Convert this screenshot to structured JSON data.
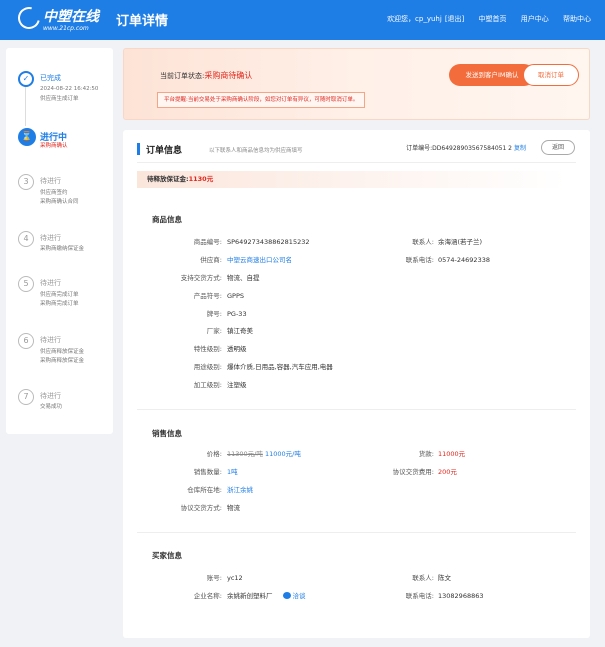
{
  "header": {
    "logo_name": "中塑在线",
    "logo_url": "www.21cp.com",
    "page_title": "订单详情",
    "welcome": "欢迎您，cp_yuhj",
    "logout": "[退出]",
    "nav": [
      "中塑首页",
      "用户中心",
      "帮助中心"
    ]
  },
  "steps": [
    {
      "num": "✓",
      "state": "done",
      "title": "已完成",
      "lines": [
        "2024-08-22 16:42:50",
        "供应商生成订单"
      ]
    },
    {
      "num": "⌛",
      "state": "active",
      "title": "进行中",
      "lines": [
        "采购商确认"
      ]
    },
    {
      "num": "3",
      "state": "pending",
      "title": "待进行",
      "lines": [
        "供应商签约",
        "采购商确认合同"
      ]
    },
    {
      "num": "4",
      "state": "pending",
      "title": "待进行",
      "lines": [
        "采购商缴纳保证金"
      ]
    },
    {
      "num": "5",
      "state": "pending",
      "title": "待进行",
      "lines": [
        "供应商完成订单",
        "采购商完成订单"
      ]
    },
    {
      "num": "6",
      "state": "pending",
      "title": "待进行",
      "lines": [
        "供应商释放保证金",
        "采购商释放保证金"
      ]
    },
    {
      "num": "7",
      "state": "pending",
      "title": "待进行",
      "lines": [
        "交易成功"
      ]
    }
  ],
  "status": {
    "label": "当前订单状态:",
    "value": "采购商待确认",
    "tip": "平台提醒:当前交易处于采购商确认阶段，如您对订单有异议，可随时取消订单。",
    "primary_btn": "发送到客户IM确认",
    "cancel_btn": "取消订单"
  },
  "order": {
    "title": "订单信息",
    "hint": "以下联系人和商品信息均为供应商填写",
    "order_no": "订单编号:DD64928903567584051 2",
    "copy": "复制",
    "back": "返回",
    "deposit_label": "待释放保证金:",
    "deposit_value": "1130元"
  },
  "goods": {
    "title": "商品信息",
    "left": [
      {
        "k": "商品编号:",
        "v": "SP649273438862815232"
      },
      {
        "k": "供应商:",
        "v": "中塑云商速出口公司名",
        "blue": true
      },
      {
        "k": "支持交货方式:",
        "v": "物流、自提"
      },
      {
        "k": "产品符号:",
        "v": "GPPS"
      },
      {
        "k": "牌号:",
        "v": "PG-33"
      },
      {
        "k": "厂家:",
        "v": "镇江奇美"
      },
      {
        "k": "特性级别:",
        "v": "透明级"
      },
      {
        "k": "用途级别:",
        "v": "爆体介质,日用品,容器,汽车应用,电器"
      },
      {
        "k": "加工级别:",
        "v": "注塑级"
      }
    ],
    "right": [
      {
        "k": "联系人:",
        "v": "余海涵(若子兰)"
      },
      {
        "k": "联系电话:",
        "v": "0574-24692338"
      }
    ]
  },
  "sales": {
    "title": "销售信息",
    "price_label": "价格:",
    "price_old": "11300元/吨",
    "price_new": "11000元/吨",
    "qty_label": "销售数量:",
    "qty": "1吨",
    "wh_label": "仓库所在地:",
    "wh": "浙江余姚",
    "delivery_label": "协议交货方式:",
    "delivery": "物流",
    "amount_label": "货款:",
    "amount": "11000元",
    "fee_label": "协议交货费用:",
    "fee": "200元"
  },
  "buyer": {
    "title": "买家信息",
    "acct_label": "账号:",
    "acct": "yc12",
    "company_label": "企业名称:",
    "company": "余姚新创塑料厂",
    "chat": "洽谈",
    "contact_label": "联系人:",
    "contact": "陈文",
    "phone_label": "联系电话:",
    "phone": "13082968863"
  }
}
